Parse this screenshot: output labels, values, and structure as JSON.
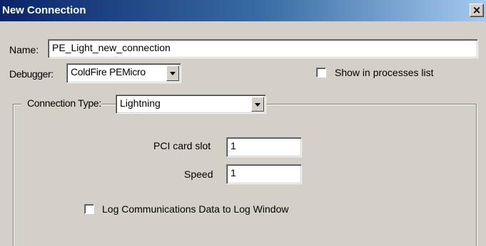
{
  "window": {
    "title": "New Connection",
    "close_glyph": "×"
  },
  "name_field": {
    "label": "Name:",
    "value": "PE_Light_new_connection"
  },
  "debugger": {
    "label": "Debugger:",
    "selected": "ColdFire PEMicro"
  },
  "show_in_processes": {
    "label": "Show in processes list",
    "checked": false
  },
  "connection_type": {
    "label": "Connection Type:",
    "selected": "Lightning"
  },
  "pci_card_slot": {
    "label": "PCI card slot",
    "value": "1"
  },
  "speed": {
    "label": "Speed",
    "value": "1"
  },
  "log_comm": {
    "label": "Log Communications Data to Log Window",
    "checked": false
  }
}
